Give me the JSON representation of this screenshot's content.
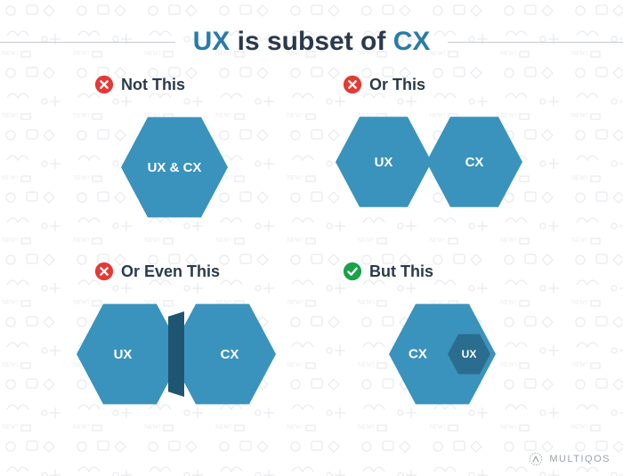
{
  "title": {
    "parts": [
      "UX",
      " is subset of ",
      "CX"
    ]
  },
  "colors": {
    "accent": "#2a7ba8",
    "hex": "#3a93bc",
    "hex_dark": "#2b6d8e",
    "overlap": "#1f5571",
    "cross": "#e53935",
    "check": "#1aa24a",
    "text": "#2a3a4d"
  },
  "panels": [
    {
      "id": "not-this",
      "mark": "cross",
      "label": "Not This",
      "shapes": [
        {
          "type": "hex",
          "size": "large",
          "text": "UX & CX"
        }
      ]
    },
    {
      "id": "or-this",
      "mark": "cross",
      "label": "Or This",
      "shapes": [
        {
          "type": "hex",
          "size": "med",
          "text": "UX"
        },
        {
          "type": "hex",
          "size": "med",
          "text": "CX"
        }
      ]
    },
    {
      "id": "or-even-this",
      "mark": "cross",
      "label": "Or Even This",
      "shapes": [
        {
          "type": "hex",
          "size": "large",
          "text": "UX"
        },
        {
          "type": "hex",
          "size": "large",
          "text": "CX"
        },
        {
          "type": "overlap"
        }
      ]
    },
    {
      "id": "but-this",
      "mark": "check",
      "label": "But This",
      "shapes": [
        {
          "type": "hex",
          "size": "large",
          "text": "CX"
        },
        {
          "type": "hex",
          "size": "small",
          "text": "UX",
          "variant": "dark"
        }
      ]
    }
  ],
  "logo": {
    "text": "MULTIQOS"
  }
}
